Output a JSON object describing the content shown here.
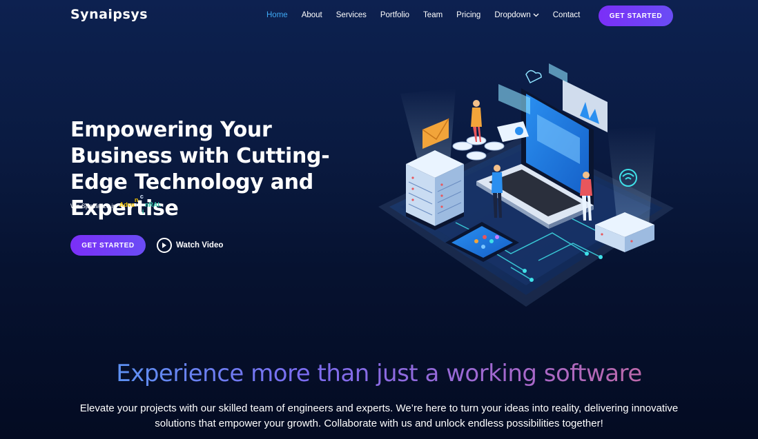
{
  "header": {
    "logo": "Synaipsys",
    "nav": [
      {
        "label": "Home",
        "active": true
      },
      {
        "label": "About"
      },
      {
        "label": "Services"
      },
      {
        "label": "Portfolio"
      },
      {
        "label": "Team"
      },
      {
        "label": "Pricing"
      },
      {
        "label": "Dropdown",
        "has_chevron": true
      },
      {
        "label": "Contact"
      }
    ],
    "cta": "GET STARTED"
  },
  "hero": {
    "title": "Empowering Your Business with Cutting-Edge Technology and Expertise",
    "specialize_prefix": "We Specialize in",
    "anim_letters": [
      {
        "t": "Adva",
        "color": "#f5c400"
      },
      {
        "t": "n",
        "color": "#f5c400"
      },
      {
        "t": "c",
        "color": "#d8e8ff"
      },
      {
        "t": "i",
        "color": "#32c6a8"
      },
      {
        "t": "nRAI.",
        "color": "#32c6a8"
      }
    ],
    "cta": "GET STARTED",
    "watch_video": "Watch Video"
  },
  "section": {
    "title": "Experience more than just a working software",
    "description": "Elevate your projects with our skilled team of engineers and experts. We’re here to turn your ideas into reality, delivering innovative solutions that empower your growth. Collaborate with us and unlock endless possibilities together!"
  },
  "colors": {
    "accent_active": "#3fa9f5",
    "button_gradient_start": "#7b2ff7",
    "button_gradient_end": "#6a4cf5",
    "background_top": "#0d2150",
    "background_bottom": "#040b22"
  },
  "icons": [
    "chevron-down-icon",
    "play-icon",
    "tech-illustration"
  ]
}
